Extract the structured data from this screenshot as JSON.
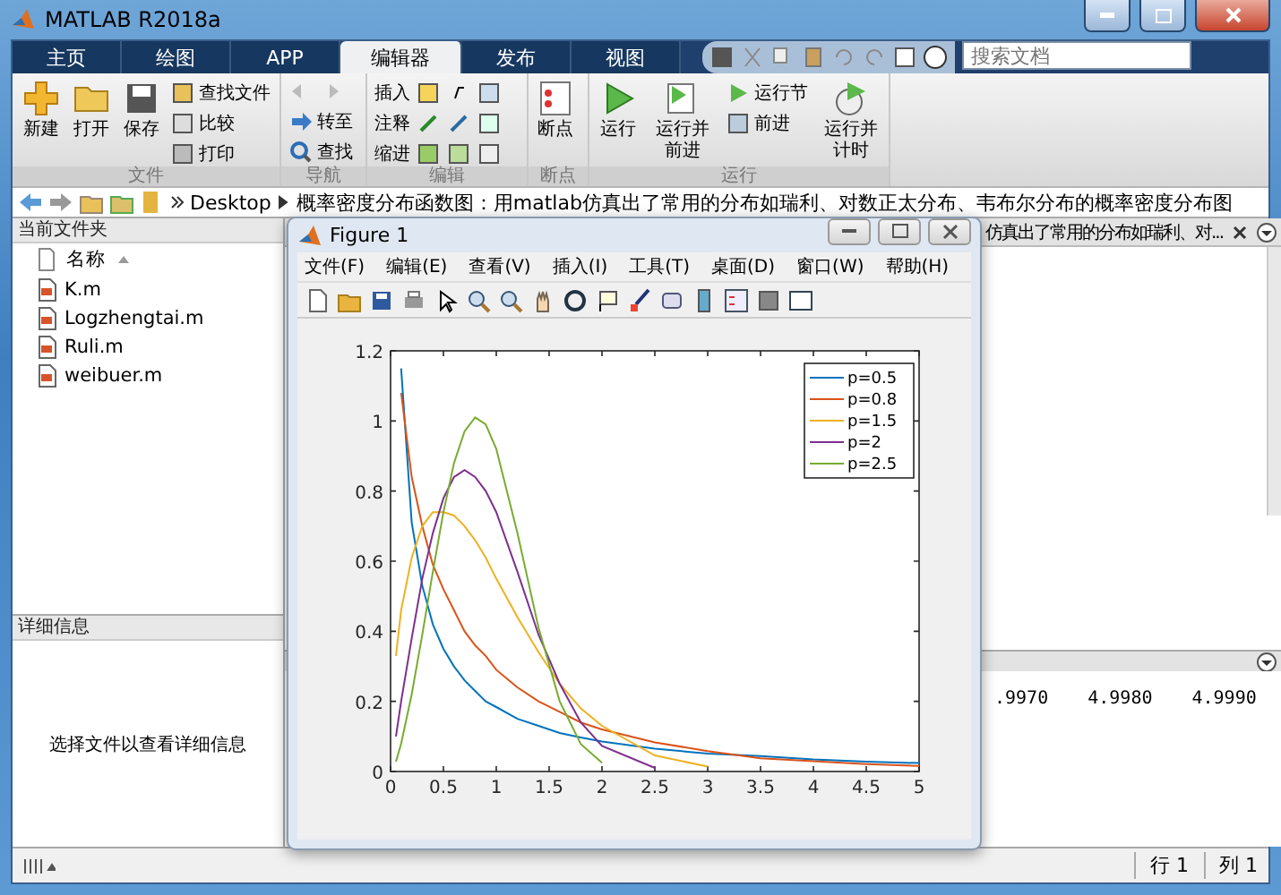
{
  "window": {
    "title": "MATLAB R2018a"
  },
  "tabs": [
    {
      "label": "主页",
      "selected": false
    },
    {
      "label": "绘图",
      "selected": false
    },
    {
      "label": "APP",
      "selected": false
    },
    {
      "label": "编辑器",
      "selected": true
    },
    {
      "label": "发布",
      "selected": false
    },
    {
      "label": "视图",
      "selected": false
    }
  ],
  "search": {
    "placeholder": "搜索文档"
  },
  "ribbon": {
    "file": {
      "label": "文件",
      "new": "新建",
      "open": "打开",
      "save": "保存",
      "find_files": "查找文件",
      "compare": "比较",
      "print": "打印"
    },
    "navigate": {
      "label": "导航",
      "go_to": "转至",
      "find": "查找"
    },
    "edit": {
      "label": "编辑",
      "insert": "插入",
      "comment": "注释",
      "indent": "缩进"
    },
    "breakpoints": {
      "label": "断点",
      "breakpoints": "断点"
    },
    "run": {
      "label": "运行",
      "run": "运行",
      "run_advance": "运行并前进",
      "run_section": "运行节",
      "advance": "前进",
      "run_time": "运行并计时"
    }
  },
  "address": {
    "path": [
      "Desktop",
      "概率密度分布函数图：用matlab仿真出了常用的分布如瑞利、对数正太分布、韦布尔分布的概率密度分布图"
    ]
  },
  "current_folder": {
    "title": "当前文件夹",
    "column": "名称",
    "files": [
      "K.m",
      "Logzhengtai.m",
      "Ruli.m",
      "weibuer.m"
    ]
  },
  "details": {
    "title": "详细信息",
    "message": "选择文件以查看详细信息"
  },
  "editor": {
    "tab_title": "仿真出了常用的分布如瑞利、对..."
  },
  "command_window": {
    "values": [
      ".9970",
      "4.9980",
      "4.9990"
    ]
  },
  "status_bar": {
    "row": "行 1",
    "col": "列 1"
  },
  "figure": {
    "title": "Figure 1",
    "menu": [
      "文件(F)",
      "编辑(E)",
      "查看(V)",
      "插入(I)",
      "工具(T)",
      "桌面(D)",
      "窗口(W)",
      "帮助(H)"
    ],
    "chart_data": {
      "type": "line",
      "legend": "top right",
      "x": [
        0.05,
        0.1,
        0.2,
        0.3,
        0.4,
        0.5,
        0.6,
        0.7,
        0.8,
        0.9,
        1,
        1.2,
        1.4,
        1.6,
        1.8,
        2,
        2.5,
        3,
        3.5,
        4,
        4.5,
        5
      ],
      "series": [
        {
          "name": "p=0.5",
          "color": "#0072bd",
          "values": [
            null,
            1.15,
            0.71,
            0.53,
            0.42,
            0.35,
            0.3,
            0.26,
            0.23,
            0.2,
            0.184,
            0.15,
            0.13,
            0.11,
            0.097,
            0.086,
            0.065,
            0.051,
            0.044,
            0.034,
            0.028,
            0.024
          ]
        },
        {
          "name": "p=0.8",
          "color": "#d95319",
          "values": [
            null,
            1.08,
            0.84,
            0.7,
            0.59,
            0.52,
            0.46,
            0.4,
            0.36,
            0.33,
            0.29,
            0.24,
            0.2,
            0.17,
            0.14,
            0.12,
            0.083,
            0.058,
            0.038,
            0.029,
            0.021,
            0.016
          ]
        },
        {
          "name": "p=1.5",
          "color": "#edb120",
          "values": [
            0.33,
            0.46,
            0.61,
            0.7,
            0.74,
            0.74,
            0.73,
            0.7,
            0.66,
            0.61,
            0.55,
            0.44,
            0.34,
            0.25,
            0.18,
            0.13,
            0.046,
            0.014,
            null,
            null,
            null,
            null
          ]
        },
        {
          "name": "p=2",
          "color": "#7e2f8e",
          "values": [
            0.1,
            0.2,
            0.38,
            0.55,
            0.68,
            0.78,
            0.84,
            0.86,
            0.84,
            0.8,
            0.74,
            0.57,
            0.39,
            0.25,
            0.14,
            0.073,
            0.01,
            null,
            null,
            null,
            null,
            null
          ]
        },
        {
          "name": "p=2.5",
          "color": "#77ac30",
          "values": [
            0.028,
            0.079,
            0.22,
            0.39,
            0.57,
            0.74,
            0.88,
            0.97,
            1.01,
            0.99,
            0.92,
            0.68,
            0.41,
            0.2,
            0.078,
            0.025,
            null,
            null,
            null,
            null,
            null,
            null
          ]
        }
      ],
      "xlim": [
        0,
        5
      ],
      "ylim": [
        0,
        1.2
      ],
      "xticks": [
        0,
        0.5,
        1,
        1.5,
        2,
        2.5,
        3,
        3.5,
        4,
        4.5,
        5
      ],
      "yticks": [
        0,
        0.2,
        0.4,
        0.6,
        0.8,
        1,
        1.2
      ]
    }
  }
}
